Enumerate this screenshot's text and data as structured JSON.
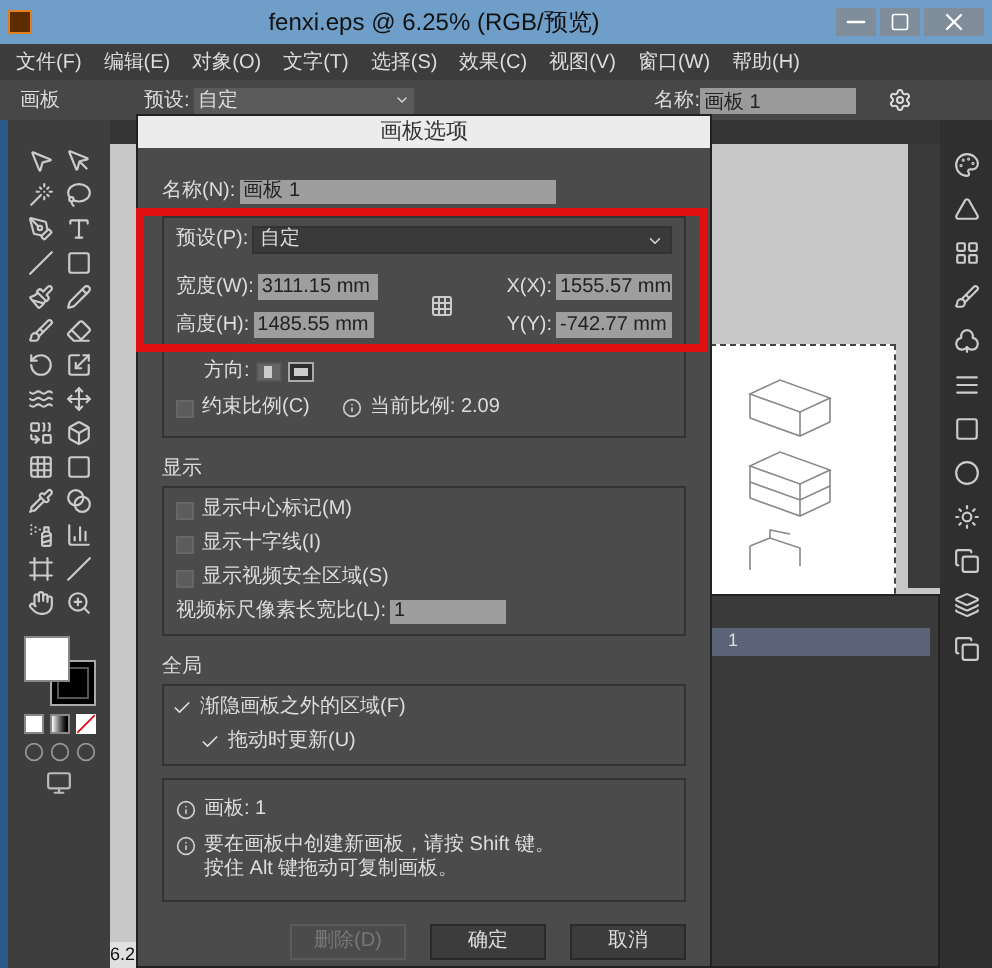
{
  "window": {
    "title": "fenxi.eps @ 6.25% (RGB/预览)"
  },
  "menu": [
    "文件(F)",
    "编辑(E)",
    "对象(O)",
    "文字(T)",
    "选择(S)",
    "效果(C)",
    "视图(V)",
    "窗口(W)",
    "帮助(H)"
  ],
  "control_bar": {
    "panel_label": "画板",
    "preset_label": "预设:",
    "preset_value": "自定",
    "name_label": "名称:",
    "name_value": "画板 1"
  },
  "dialog": {
    "title": "画板选项",
    "name_label": "名称(N):",
    "name_value": "画板 1",
    "preset_label": "预设(P):",
    "preset_value": "自定",
    "fields": [
      {
        "label": "宽度(W):",
        "value": "3111.15 mm"
      },
      {
        "label": "高度(H):",
        "value": "1485.55 mm"
      },
      {
        "label": "X(X):",
        "value": "1555.57 mm"
      },
      {
        "label": "Y(Y):",
        "value": "-742.77 mm"
      }
    ],
    "orientation_label": "方向:",
    "orientations": [
      {
        "kind": "portrait",
        "selected": false
      },
      {
        "kind": "landscape",
        "selected": true
      }
    ],
    "constrain": {
      "label": "约束比例(C)",
      "checked": false
    },
    "ratio": "当前比例: 2.09",
    "display": {
      "title": "显示",
      "checks": [
        {
          "label": "显示中心标记(M)",
          "checked": false
        },
        {
          "label": "显示十字线(I)",
          "checked": false
        },
        {
          "label": "显示视频安全区域(S)",
          "checked": false
        }
      ],
      "ruler_label": "视频标尺像素长宽比(L):",
      "ruler_value": "1"
    },
    "global": {
      "title": "全局",
      "checks": [
        {
          "label": "渐隐画板之外的区域(F)",
          "checked": true,
          "children": [
            {
              "label": "拖动时更新(U)",
              "checked": true
            }
          ]
        }
      ]
    },
    "info": [
      {
        "lines": [
          "画板: 1"
        ]
      },
      {
        "lines": [
          "要在画板中创建新画板，请按 Shift 键。",
          "按住 Alt 键拖动可复制画板。"
        ]
      }
    ],
    "buttons": [
      {
        "label": "删除(D)",
        "disabled": true
      },
      {
        "label": "确定",
        "disabled": false
      },
      {
        "label": "取消",
        "disabled": false
      }
    ]
  },
  "artboards_panel": {
    "rows": [
      {
        "label": "1",
        "selected": true
      }
    ]
  },
  "status": {
    "zoom": "6.2"
  }
}
